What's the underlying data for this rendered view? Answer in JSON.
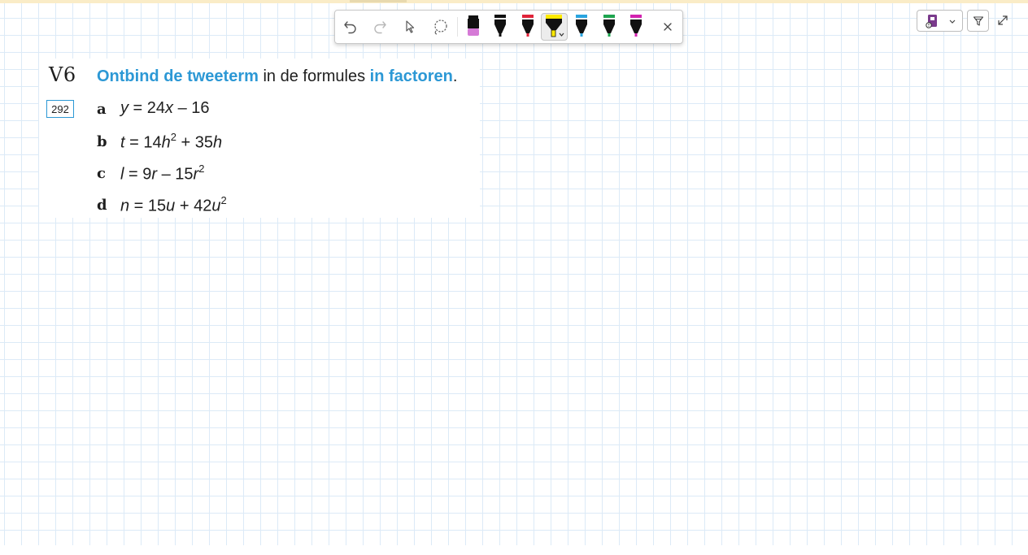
{
  "toolbar": {
    "tools": [
      {
        "name": "undo-icon"
      },
      {
        "name": "redo-icon"
      },
      {
        "name": "select-pointer-icon"
      },
      {
        "name": "lasso-icon"
      },
      {
        "name": "pen-black-pink",
        "color": "#111111",
        "accent": "#d57ad6"
      },
      {
        "name": "pen-black",
        "color": "#111111"
      },
      {
        "name": "pen-red",
        "color": "#e0243a"
      },
      {
        "name": "highlighter-yellow",
        "color": "#ffea00",
        "selected": true
      },
      {
        "name": "pen-blue",
        "color": "#29a4df"
      },
      {
        "name": "pen-green",
        "color": "#1ea44f"
      },
      {
        "name": "pen-magenta",
        "color": "#d323b0"
      },
      {
        "name": "close-icon"
      }
    ]
  },
  "exercise": {
    "number": "V6",
    "page_ref": "292",
    "instruction": {
      "part1": "Ontbind de tweeterm",
      "part2": " in de formules ",
      "part3": "in factoren",
      "part4": "."
    },
    "items": [
      {
        "letter": "a",
        "lhs": "y",
        "eq": " = 24",
        "v1": "x",
        "rest": " – 16"
      },
      {
        "letter": "b",
        "lhs": "t",
        "eq": " = 14",
        "v1": "h",
        "sup1": "2",
        "mid": " + 35",
        "v2": "h"
      },
      {
        "letter": "c",
        "lhs": "l",
        "eq": " = 9",
        "v1": "r",
        "mid": " – 15",
        "v2": "r",
        "sup2": "2"
      },
      {
        "letter": "d",
        "lhs": "n",
        "eq": " = 15",
        "v1": "u",
        "mid": " + 42",
        "v2": "u",
        "sup2": "2"
      }
    ]
  },
  "colors": {
    "accent": "#2c98d5",
    "grid": "#dceaf7",
    "top_strip": "#faecc7"
  }
}
